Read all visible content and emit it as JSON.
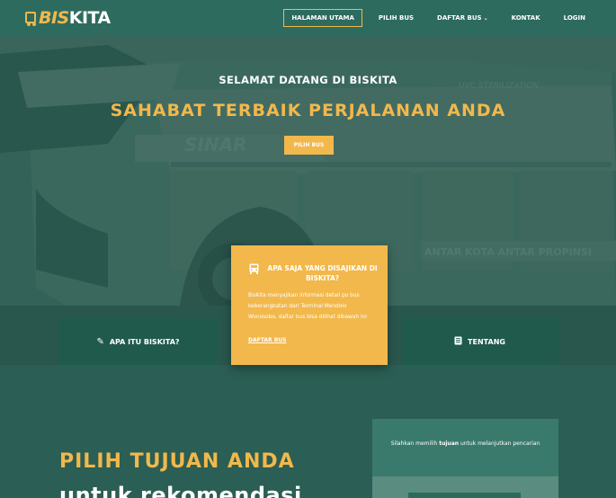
{
  "brand": {
    "logo_part1": "BIS",
    "logo_part2": "KITA"
  },
  "nav": {
    "items": [
      {
        "label": "HALAMAN UTAMA"
      },
      {
        "label": "PILIH BUS"
      },
      {
        "label": "DAFTAR BUS"
      },
      {
        "label": "KONTAK"
      },
      {
        "label": "LOGIN"
      }
    ]
  },
  "hero": {
    "subtitle": "SELAMAT DATANG DI BISKITA",
    "title": "SAHABAT TERBAIK PERJALANAN ANDA",
    "button_label": "PILIH BUS"
  },
  "features": {
    "left": {
      "label": "APA ITU BISKITA?",
      "icon": "pencil-icon"
    },
    "center": {
      "heading": "APA SAJA YANG DISAJIKAN DI BISKITA?",
      "icon": "bus-icon",
      "description": "BisKita menyajikan informasi detail po bus keberangkatan dari Terminal Mendolo Wonosobo, daftar bus bisa dilihat dibawah ini",
      "link_label": "DAFTAR BUS"
    },
    "right": {
      "label": "TENTANG",
      "icon": "book-icon"
    }
  },
  "section": {
    "title": "PILIH TUJUAN ANDA",
    "subtitle": "untuk rekomendasi",
    "card_text_before": "Silahkan memilih ",
    "card_text_bold": "tujuan",
    "card_text_after": " untuk melanjutkan pencarian"
  },
  "colors": {
    "primary": "#2e6b5f",
    "accent": "#f2b84b",
    "dark_box": "#1f5a4d"
  }
}
